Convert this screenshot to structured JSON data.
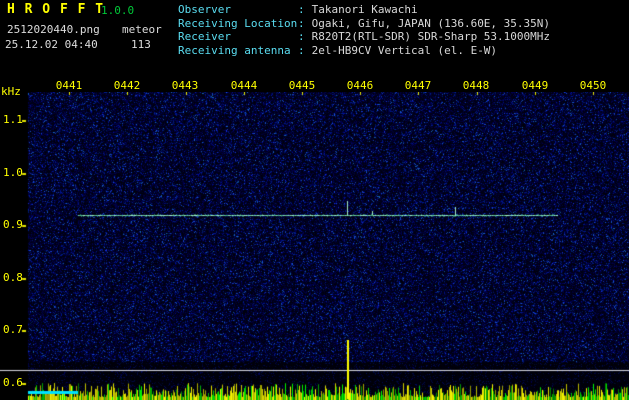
{
  "header": {
    "app_name": "H R O F F T",
    "version": "1.0.0",
    "filename": "2512020440.png",
    "mode": "meteor",
    "datetime": "25.12.02 04:40",
    "count": "113",
    "colon": ":",
    "info": [
      {
        "label": "Observer",
        "value": "Takanori Kawachi"
      },
      {
        "label": "Receiving Location",
        "value": "Ogaki, Gifu, JAPAN (136.60E, 35.35N)"
      },
      {
        "label": "Receiver",
        "value": "R820T2(RTL-SDR) SDR-Sharp 53.1000MHz"
      },
      {
        "label": "Receiving antenna",
        "value": "2el-HB9CV Vertical (el. E-W)"
      }
    ]
  },
  "chart_data": {
    "type": "heatmap",
    "title": "HROFFT 10-minute radio meteor echo spectrogram 04:40-04:50",
    "x_axis": {
      "tick_labels": [
        "0441",
        "0442",
        "0443",
        "0444",
        "0445",
        "0446",
        "0447",
        "0448",
        "0449",
        "0450"
      ],
      "span_minutes": 10
    },
    "y_axis": {
      "label": "kHz",
      "tick_labels": [
        "1.1",
        "1.0",
        "0.9",
        "0.8",
        "0.7",
        "0.6"
      ],
      "min_khz": 0.57,
      "max_khz": 1.15
    },
    "carrier_line": {
      "freq_khz": 0.92,
      "start_min": 1.15,
      "end_min": 9.38
    },
    "echoes": [
      {
        "t_min": 5.78,
        "freq_khz": 0.92,
        "spike_khz": 0.027,
        "level": "strong"
      },
      {
        "t_min": 6.2,
        "freq_khz": 0.92,
        "spike_khz": 0.008,
        "level": "weak"
      },
      {
        "t_min": 7.63,
        "freq_khz": 0.92,
        "spike_khz": 0.016,
        "level": "weak"
      }
    ],
    "bottom_strip": {
      "spike_t_min": 5.78
    },
    "palette": {
      "background": "#000000",
      "noise_blue": "#2038b4",
      "carrier_green": "#64dca0",
      "axis_yellow": "#e6e600",
      "label_yellow": "#ffff00",
      "ref_line_white": "#d7d7e1",
      "strip_yellow": "#c8c800",
      "strip_green": "#00b400",
      "marker_cyan": "#00e1ff",
      "header_cyan": "#5adcf0",
      "header_text": "#d8d8d8",
      "version_green": "#00c838"
    }
  }
}
